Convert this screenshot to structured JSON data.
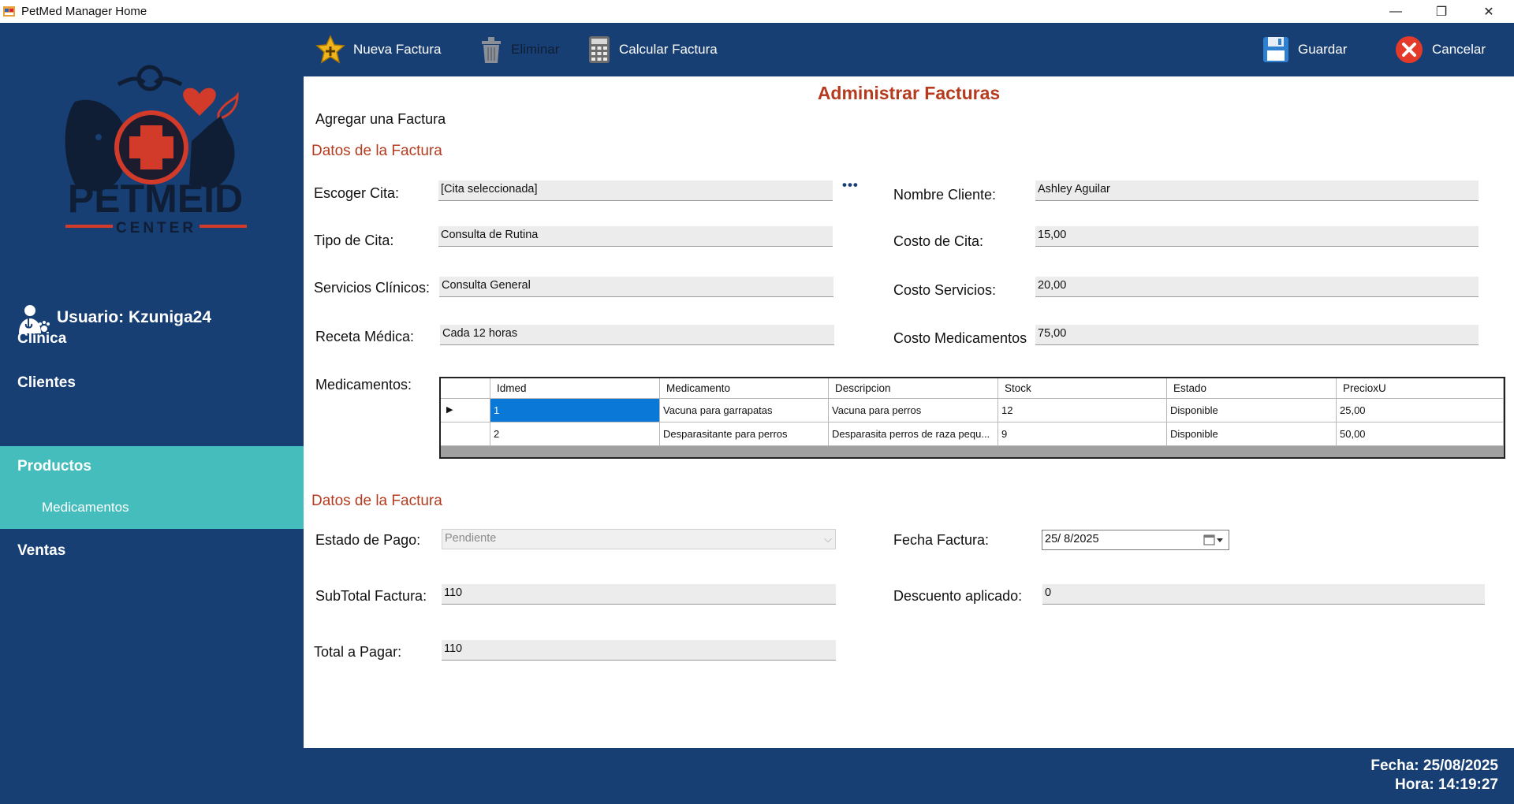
{
  "window": {
    "title": "PetMed Manager Home",
    "minimize": "—",
    "maximize": "❐",
    "close": "✕"
  },
  "logo": {
    "line1": "PETMEID",
    "line2": "CENTER"
  },
  "user": {
    "label": "Usuario: Kzuniga24"
  },
  "nav": {
    "items": [
      {
        "label": "Clínica"
      },
      {
        "label": "Clientes"
      },
      {
        "label": "Productos"
      },
      {
        "label": "Medicamentos"
      },
      {
        "label": "Ventas"
      }
    ],
    "active": "Productos",
    "active_color": "#45bdbd"
  },
  "toolbar": {
    "new_label": "Nueva Factura",
    "delete_label": "Eliminar",
    "calc_label": "Calcular Factura",
    "save_label": "Guardar",
    "cancel_label": "Cancelar"
  },
  "page": {
    "title": "Administrar Facturas",
    "subtitle": "Agregar una Factura",
    "section1": "Datos de la Factura",
    "section2": "Datos de la Factura"
  },
  "form": {
    "cita_label": "Escoger Cita:",
    "cita_value": "[Cita seleccionada]",
    "more_button": "•••",
    "tipo_label": "Tipo de Cita:",
    "tipo_value": "Consulta de Rutina",
    "servicios_label": "Servicios Clínicos:",
    "servicios_value": "Consulta General",
    "receta_label": "Receta Médica:",
    "receta_value": "Cada 12 horas",
    "cliente_label": "Nombre Cliente:",
    "cliente_value": "Ashley Aguilar",
    "costo_cita_label": "Costo de Cita:",
    "costo_cita_value": "15,00",
    "costo_serv_label": "Costo Servicios:",
    "costo_serv_value": "20,00",
    "costo_med_label": "Costo Medicamentos",
    "costo_med_value": "75,00",
    "medicamentos_label": "Medicamentos:",
    "estado_label": "Estado de Pago:",
    "estado_value": "Pendiente",
    "subtotal_label": "SubTotal Factura:",
    "subtotal_value": "110",
    "total_label": "Total a Pagar:",
    "total_value": "110",
    "fecha_label": "Fecha Factura:",
    "fecha_value": "25/  8/2025",
    "descuento_label": "Descuento aplicado:",
    "descuento_value": "0"
  },
  "grid": {
    "columns": [
      "Idmed",
      "Medicamento",
      "Descripcion",
      "Stock",
      "Estado",
      "PrecioxU"
    ],
    "rows": [
      [
        "1",
        "Vacuna para garrapatas",
        "Vacuna para perros",
        "12",
        "Disponible",
        "25,00"
      ],
      [
        "2",
        "Desparasitante para perros",
        "Desparasita perros de raza pequ...",
        "9",
        "Disponible",
        "50,00"
      ]
    ],
    "selected_color": "#0a78d7"
  },
  "footer": {
    "fecha": "Fecha: 25/08/2025",
    "hora": "Hora: 14:19:27"
  }
}
